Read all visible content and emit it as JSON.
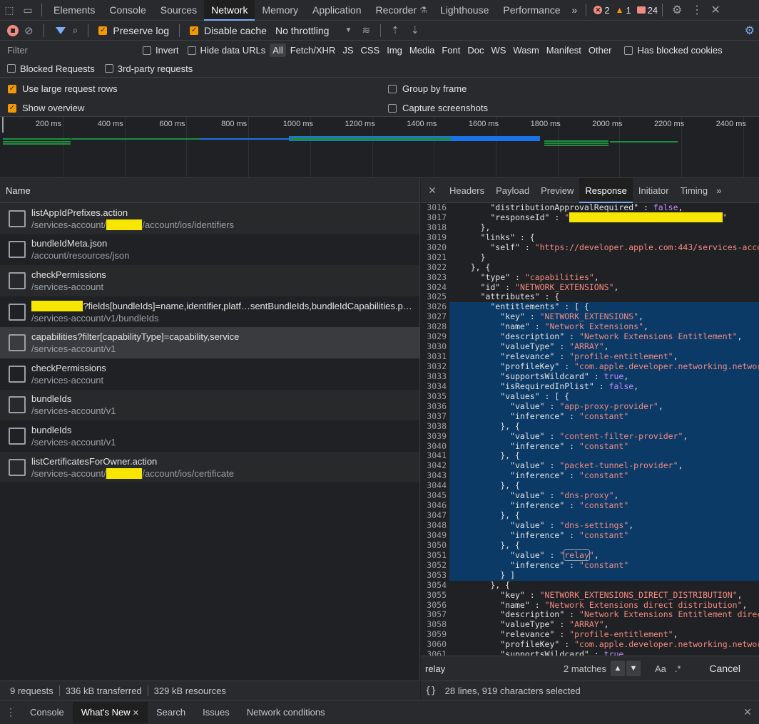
{
  "topbar": {
    "tabs": [
      "Elements",
      "Console",
      "Sources",
      "Network",
      "Memory",
      "Application",
      "Recorder",
      "Lighthouse",
      "Performance"
    ],
    "active_tab": "Network",
    "more": "»",
    "errors": "2",
    "warnings": "1",
    "issues": "24"
  },
  "toolbar": {
    "preserve_log": "Preserve log",
    "disable_cache": "Disable cache",
    "throttling": "No throttling"
  },
  "filter": {
    "placeholder": "Filter",
    "invert": "Invert",
    "hide_data_urls": "Hide data URLs",
    "types": [
      "All",
      "Fetch/XHR",
      "JS",
      "CSS",
      "Img",
      "Media",
      "Font",
      "Doc",
      "WS",
      "Wasm",
      "Manifest",
      "Other"
    ],
    "active_type": "All",
    "blocked_cookies": "Has blocked cookies",
    "blocked_requests": "Blocked Requests",
    "third_party": "3rd-party requests"
  },
  "settings": {
    "large_rows": "Use large request rows",
    "show_overview": "Show overview",
    "group_by_frame": "Group by frame",
    "capture_screenshots": "Capture screenshots"
  },
  "overview": {
    "ticks": [
      "200 ms",
      "400 ms",
      "600 ms",
      "800 ms",
      "1000 ms",
      "1200 ms",
      "1400 ms",
      "1600 ms",
      "1800 ms",
      "2000 ms",
      "2200 ms",
      "2400 ms"
    ]
  },
  "requests_header": "Name",
  "requests": [
    {
      "name": "listAppIdPrefixes.action",
      "path_pre": "/services-account/",
      "path_redacted": true,
      "path_post": "/account/ios/identifiers"
    },
    {
      "name": "bundleIdMeta.json",
      "path_pre": "/account/resources/json",
      "path_redacted": false,
      "path_post": ""
    },
    {
      "name": "checkPermissions",
      "path_pre": "/services-account",
      "path_redacted": false,
      "path_post": ""
    },
    {
      "name": "?fields[bundleIds]=name,identifier,platf…sentBundleIds,bundleIdCapabilities.p…",
      "name_redacted": true,
      "path_pre": "/services-account/v1/bundleIds",
      "path_redacted": false,
      "path_post": ""
    },
    {
      "name": "capabilities?filter[capabilityType]=capability,service",
      "path_pre": "/services-account/v1",
      "path_redacted": false,
      "path_post": ""
    },
    {
      "name": "checkPermissions",
      "path_pre": "/services-account",
      "path_redacted": false,
      "path_post": ""
    },
    {
      "name": "bundleIds",
      "path_pre": "/services-account/v1",
      "path_redacted": false,
      "path_post": ""
    },
    {
      "name": "bundleIds",
      "path_pre": "/services-account/v1",
      "path_redacted": false,
      "path_post": ""
    },
    {
      "name": "listCertificatesForOwner.action",
      "path_pre": "/services-account/",
      "path_redacted": true,
      "path_post": "/account/ios/certificate"
    }
  ],
  "detail_tabs": [
    "Headers",
    "Payload",
    "Preview",
    "Response",
    "Initiator",
    "Timing"
  ],
  "detail_active": "Response",
  "code_lines": [
    {
      "n": "3016",
      "t": "        \"distributionApprovalRequired\" : false,"
    },
    {
      "n": "3017",
      "t": "        \"responseId\" : \""
    },
    {
      "n": "3018",
      "t": "      },"
    },
    {
      "n": "3019",
      "t": "      \"links\" : {"
    },
    {
      "n": "3020",
      "t": "        \"self\" : \"https://developer.apple.com:443/services-acco"
    },
    {
      "n": "3021",
      "t": "      }"
    },
    {
      "n": "3022",
      "t": "    }, {"
    },
    {
      "n": "3023",
      "t": "      \"type\" : \"capabilities\","
    },
    {
      "n": "3024",
      "t": "      \"id\" : \"NETWORK_EXTENSIONS\","
    },
    {
      "n": "3025",
      "t": "      \"attributes\" : {"
    },
    {
      "n": "3026",
      "t": "        \"entitlements\" : [ {"
    },
    {
      "n": "3027",
      "t": "          \"key\" : \"NETWORK_EXTENSIONS\","
    },
    {
      "n": "3028",
      "t": "          \"name\" : \"Network Extensions\","
    },
    {
      "n": "3029",
      "t": "          \"description\" : \"Network Extensions Entitlement\","
    },
    {
      "n": "3030",
      "t": "          \"valueType\" : \"ARRAY\","
    },
    {
      "n": "3031",
      "t": "          \"relevance\" : \"profile-entitlement\","
    },
    {
      "n": "3032",
      "t": "          \"profileKey\" : \"com.apple.developer.networking.networ"
    },
    {
      "n": "3033",
      "t": "          \"supportsWildcard\" : true,"
    },
    {
      "n": "3034",
      "t": "          \"isRequiredInPlist\" : false,"
    },
    {
      "n": "3035",
      "t": "          \"values\" : [ {"
    },
    {
      "n": "3036",
      "t": "            \"value\" : \"app-proxy-provider\","
    },
    {
      "n": "3037",
      "t": "            \"inference\" : \"constant\""
    },
    {
      "n": "3038",
      "t": "          }, {"
    },
    {
      "n": "3039",
      "t": "            \"value\" : \"content-filter-provider\","
    },
    {
      "n": "3040",
      "t": "            \"inference\" : \"constant\""
    },
    {
      "n": "3041",
      "t": "          }, {"
    },
    {
      "n": "3042",
      "t": "            \"value\" : \"packet-tunnel-provider\","
    },
    {
      "n": "3043",
      "t": "            \"inference\" : \"constant\""
    },
    {
      "n": "3044",
      "t": "          }, {"
    },
    {
      "n": "3045",
      "t": "            \"value\" : \"dns-proxy\","
    },
    {
      "n": "3046",
      "t": "            \"inference\" : \"constant\""
    },
    {
      "n": "3047",
      "t": "          }, {"
    },
    {
      "n": "3048",
      "t": "            \"value\" : \"dns-settings\","
    },
    {
      "n": "3049",
      "t": "            \"inference\" : \"constant\""
    },
    {
      "n": "3050",
      "t": "          }, {"
    },
    {
      "n": "3051",
      "t": "            \"value\" : \"relay\","
    },
    {
      "n": "3052",
      "t": "            \"inference\" : \"constant\""
    },
    {
      "n": "3053",
      "t": "          } ]"
    },
    {
      "n": "3054",
      "t": "        }, {"
    },
    {
      "n": "3055",
      "t": "          \"key\" : \"NETWORK_EXTENSIONS_DIRECT_DISTRIBUTION\","
    },
    {
      "n": "3056",
      "t": "          \"name\" : \"Network Extensions direct distribution\","
    },
    {
      "n": "3057",
      "t": "          \"description\" : \"Network Extensions Entitlement direc"
    },
    {
      "n": "3058",
      "t": "          \"valueType\" : \"ARRAY\","
    },
    {
      "n": "3059",
      "t": "          \"relevance\" : \"profile-entitlement\","
    },
    {
      "n": "3060",
      "t": "          \"profileKey\" : \"com.apple.developer.networking.networ"
    },
    {
      "n": "3061",
      "t": "          \"supportsWildcard\" : true,"
    }
  ],
  "search": {
    "value": "relay",
    "matches": "2 matches",
    "case_label": "Aa",
    "regex_label": ".*",
    "cancel": "Cancel"
  },
  "status": {
    "requests": "9 requests",
    "transferred": "336 kB transferred",
    "resources": "329 kB resources",
    "selection": "28 lines, 919 characters selected",
    "braces": "{}"
  },
  "drawer": {
    "tabs": [
      "Console",
      "What's New",
      "Search",
      "Issues",
      "Network conditions"
    ],
    "active": "What's New"
  },
  "colors": {
    "accent": "#7cacf8",
    "checkbox": "#f29900",
    "selection": "#0b3a66",
    "string": "#f28b82",
    "redaction": "#f6e600"
  }
}
